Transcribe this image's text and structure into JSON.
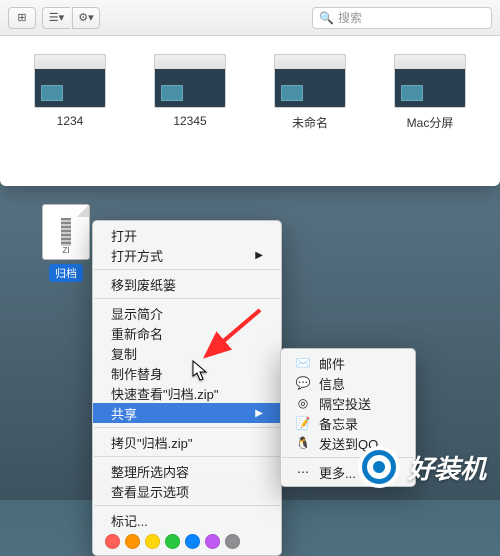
{
  "toolbar": {
    "search_placeholder": "搜索"
  },
  "files": [
    {
      "label": "1234"
    },
    {
      "label": "12345"
    },
    {
      "label": "未命名"
    },
    {
      "label": "Mac分屏"
    }
  ],
  "selected_file": {
    "icon_text": "ZI",
    "label": "归档"
  },
  "context_menu": {
    "open": "打开",
    "open_with": "打开方式",
    "move_to_trash": "移到废纸篓",
    "get_info": "显示简介",
    "rename": "重新命名",
    "copy": "复制",
    "make_alias": "制作替身",
    "quick_look": "快速查看\"归档.zip\"",
    "share": "共享",
    "copy_item": "拷贝\"归档.zip\"",
    "clean_up": "整理所选内容",
    "view_options": "查看显示选项",
    "tags": "标记..."
  },
  "tag_colors": [
    "#ff5f57",
    "#ffbd2e",
    "#ffd60a",
    "#28c840",
    "#0a84ff",
    "#bf5af2",
    "#8e8e93"
  ],
  "submenu": {
    "mail": "邮件",
    "messages": "信息",
    "airdrop": "隔空投送",
    "notes": "备忘录",
    "qq": "发送到QQ",
    "more": "更多..."
  },
  "watermark": "好装机"
}
